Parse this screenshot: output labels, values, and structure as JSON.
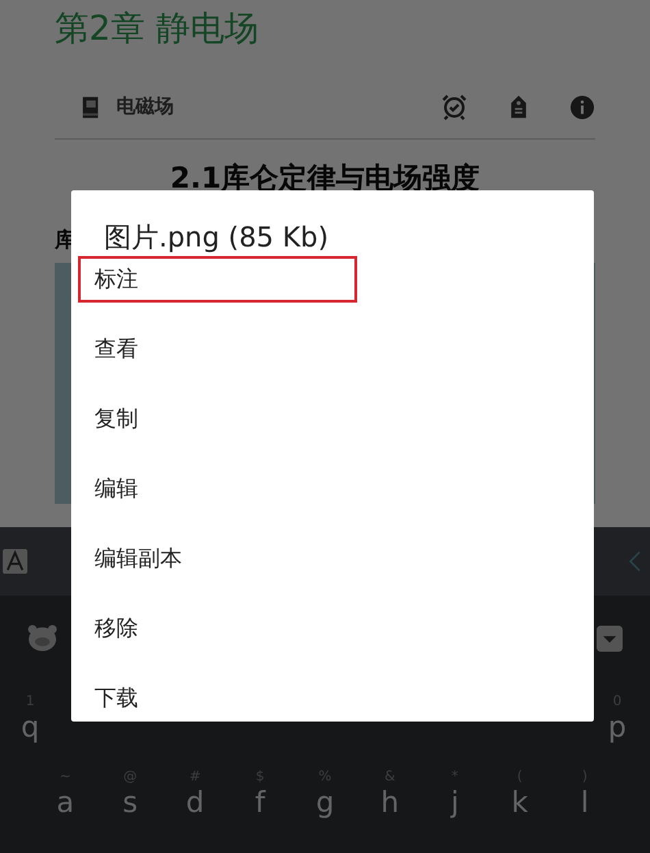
{
  "note": {
    "title": "第2章 静电场",
    "notebook": "电磁场",
    "heading": "2.1库仑定律与电场强度",
    "paragraph_start": "库"
  },
  "dialog": {
    "title": "图片.png (85 Kb)",
    "items": [
      {
        "label": "标注",
        "highlighted": true
      },
      {
        "label": "查看",
        "highlighted": false
      },
      {
        "label": "复制",
        "highlighted": false
      },
      {
        "label": "编辑",
        "highlighted": false
      },
      {
        "label": "编辑副本",
        "highlighted": false
      },
      {
        "label": "移除",
        "highlighted": false
      },
      {
        "label": "下载",
        "highlighted": false
      }
    ]
  },
  "keyboard": {
    "rows": [
      [
        {
          "key": "q",
          "hint": "1"
        },
        {
          "key": "p",
          "hint": "0"
        }
      ],
      [
        {
          "key": "a",
          "hint": "~"
        },
        {
          "key": "s",
          "hint": "@"
        },
        {
          "key": "d",
          "hint": "#"
        },
        {
          "key": "f",
          "hint": "$"
        },
        {
          "key": "g",
          "hint": "%"
        },
        {
          "key": "h",
          "hint": "&"
        },
        {
          "key": "j",
          "hint": "*"
        },
        {
          "key": "k",
          "hint": "("
        },
        {
          "key": "l",
          "hint": ")"
        }
      ]
    ]
  }
}
